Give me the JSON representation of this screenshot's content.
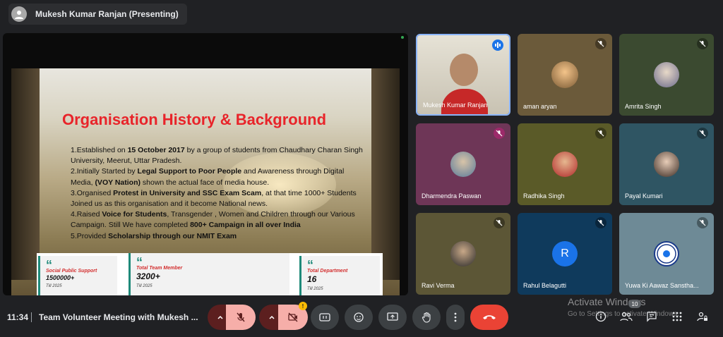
{
  "presenter_bar": {
    "title": "Mukesh Kumar Ranjan (Presenting)"
  },
  "slide": {
    "title": "Organisation History & Background",
    "points": [
      {
        "pre": "1.Established on ",
        "b1": "15 October 2017",
        "mid": " by a group of students from Chaudhary Charan Singh University, Meerut, Uttar Pradesh.",
        "b2": "",
        "post": ""
      },
      {
        "pre": "2.Initially Started by ",
        "b1": "Legal Support to Poor People",
        "mid": " and Awareness through Digital Media, ",
        "b2": "(VOY Nation)",
        "post": " shown the actual face of media house."
      },
      {
        "pre": "3.Organised ",
        "b1": "Protest in University and SSC Exam Scam",
        "mid": ", at that time 1000+ Students Joined us as this organisation and it become National news.",
        "b2": "",
        "post": ""
      },
      {
        "pre": "4.Raised ",
        "b1": "Voice for Students",
        "mid": ", Transgender , Women and Children through our Various Campaign. Still We have completed ",
        "b2": "800+ Campaign in all over India",
        "post": ""
      },
      {
        "pre": "5.Provided ",
        "b1": "Scholarship through our NMIT Exam",
        "mid": "",
        "b2": "",
        "post": ""
      }
    ],
    "stats": [
      {
        "label": "Social Public Support",
        "value": "1500000+",
        "till": "Till 2025"
      },
      {
        "label": "Total Team Member",
        "value": "3200+",
        "till": "Till 2025"
      },
      {
        "label": "Total Department",
        "value": "16",
        "till": "Till 2025"
      }
    ]
  },
  "participants": [
    {
      "name": "Mukesh Kumar Ranjan",
      "bg": "#d9d4c8",
      "speaking": true
    },
    {
      "name": "aman aryan",
      "bg": "#6b5a3a"
    },
    {
      "name": "Amrita Singh",
      "bg": "#3b4a30"
    },
    {
      "name": "Dharmendra Paswan",
      "bg": "#6e3657"
    },
    {
      "name": "Radhika Singh",
      "bg": "#5a5a28"
    },
    {
      "name": "Payal Kumari",
      "bg": "#2f5563"
    },
    {
      "name": "Ravi Verma",
      "bg": "#5c5636"
    },
    {
      "name": "Rahul Belagutti",
      "bg": "#0f3a5c",
      "letter": "R"
    },
    {
      "name": "Yuwa Ki Aawaz Sanstha...",
      "bg": "#6e8a96"
    }
  ],
  "bottom": {
    "time": "11:34",
    "meeting_title": "Team Volunteer Meeting with Mukesh ...",
    "badge": "!",
    "people_count": "10",
    "watermark_line1": "Activate Windows",
    "watermark_line2": "Go to Settings to activate Windows."
  }
}
